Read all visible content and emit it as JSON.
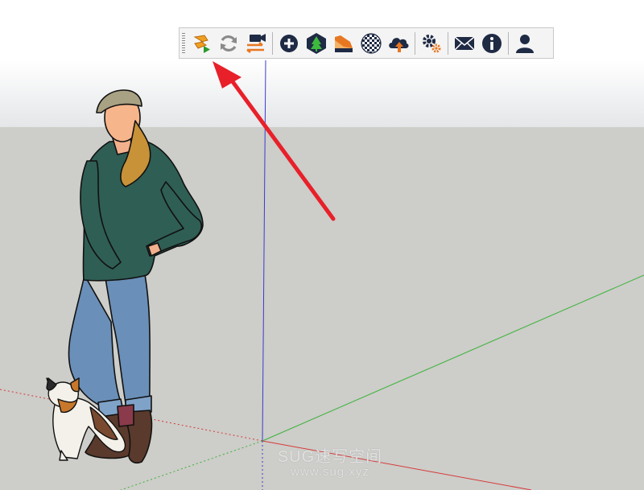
{
  "toolbar": {
    "buttons": [
      {
        "name": "render-start-button",
        "icon": "edge-play-icon"
      },
      {
        "name": "refresh-button",
        "icon": "refresh-icon"
      },
      {
        "name": "video-export-button",
        "icon": "video-camera-icon"
      },
      {
        "name": "add-button",
        "icon": "plus-circle-icon"
      },
      {
        "name": "tree-asset-button",
        "icon": "tree-icon"
      },
      {
        "name": "material-swatch-button",
        "icon": "material-swatch-icon"
      },
      {
        "name": "checker-sphere-button",
        "icon": "checker-sphere-icon"
      },
      {
        "name": "cloud-upload-button",
        "icon": "cloud-upload-icon"
      },
      {
        "name": "settings-button",
        "icon": "gears-icon"
      },
      {
        "name": "mail-button",
        "icon": "mail-icon"
      },
      {
        "name": "info-button",
        "icon": "info-icon"
      },
      {
        "name": "account-button",
        "icon": "user-icon"
      }
    ]
  },
  "watermark": {
    "line1": "SUG速写空间",
    "line2": "www.sug.xyz"
  },
  "colors": {
    "ground": "#cdcdc9",
    "sky_top": "#ffffff",
    "sky_bottom": "#e4e6e8",
    "blue_axis": "#3b3bd0",
    "green_axis": "#3ab33a",
    "red_axis": "#d63a3a",
    "arrow": "#e8202a",
    "icon_dark": "#1f2a44",
    "icon_orange": "#e87722"
  }
}
